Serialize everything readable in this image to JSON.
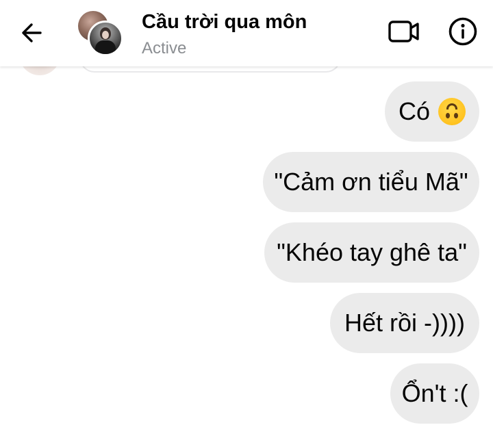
{
  "header": {
    "title": "Cầu trời qua môn",
    "status": "Active",
    "icons": {
      "back": "arrow-left-icon",
      "video": "video-camera-icon",
      "info": "info-circle-icon"
    }
  },
  "messages": [
    {
      "text": "Có",
      "emoji": "upside-down-face-emoji",
      "sender": "me"
    },
    {
      "text": "\"Cảm ơn tiểu Mã\"",
      "sender": "me"
    },
    {
      "text": "\"Khéo tay ghê ta\"",
      "sender": "me"
    },
    {
      "text": "Hết rồi -))))",
      "sender": "me"
    },
    {
      "text": "Ổn't :(",
      "sender": "me"
    }
  ],
  "colors": {
    "bubble_bg": "#ebebeb",
    "text": "#050505",
    "status_text": "#8a8d91"
  }
}
